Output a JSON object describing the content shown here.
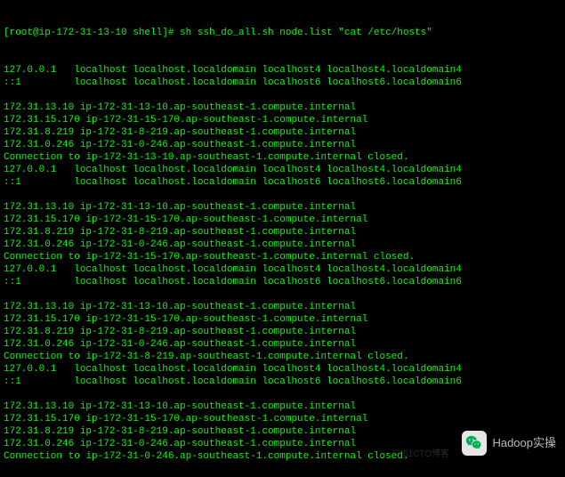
{
  "prompt": "[root@ip-172-31-13-10 shell]# sh ssh_do_all.sh node.list \"cat /etc/hosts\"",
  "lines": [
    "127.0.0.1   localhost localhost.localdomain localhost4 localhost4.localdomain4",
    "::1         localhost localhost.localdomain localhost6 localhost6.localdomain6",
    "",
    "172.31.13.10 ip-172-31-13-10.ap-southeast-1.compute.internal",
    "172.31.15.170 ip-172-31-15-170.ap-southeast-1.compute.internal",
    "172.31.8.219 ip-172-31-8-219.ap-southeast-1.compute.internal",
    "172.31.0.246 ip-172-31-0-246.ap-southeast-1.compute.internal",
    "Connection to ip-172-31-13-10.ap-southeast-1.compute.internal closed.",
    "127.0.0.1   localhost localhost.localdomain localhost4 localhost4.localdomain4",
    "::1         localhost localhost.localdomain localhost6 localhost6.localdomain6",
    "",
    "172.31.13.10 ip-172-31-13-10.ap-southeast-1.compute.internal",
    "172.31.15.170 ip-172-31-15-170.ap-southeast-1.compute.internal",
    "172.31.8.219 ip-172-31-8-219.ap-southeast-1.compute.internal",
    "172.31.0.246 ip-172-31-0-246.ap-southeast-1.compute.internal",
    "Connection to ip-172-31-15-170.ap-southeast-1.compute.internal closed.",
    "127.0.0.1   localhost localhost.localdomain localhost4 localhost4.localdomain4",
    "::1         localhost localhost.localdomain localhost6 localhost6.localdomain6",
    "",
    "172.31.13.10 ip-172-31-13-10.ap-southeast-1.compute.internal",
    "172.31.15.170 ip-172-31-15-170.ap-southeast-1.compute.internal",
    "172.31.8.219 ip-172-31-8-219.ap-southeast-1.compute.internal",
    "172.31.0.246 ip-172-31-0-246.ap-southeast-1.compute.internal",
    "Connection to ip-172-31-8-219.ap-southeast-1.compute.internal closed.",
    "127.0.0.1   localhost localhost.localdomain localhost4 localhost4.localdomain4",
    "::1         localhost localhost.localdomain localhost6 localhost6.localdomain6",
    "",
    "172.31.13.10 ip-172-31-13-10.ap-southeast-1.compute.internal",
    "172.31.15.170 ip-172-31-15-170.ap-southeast-1.compute.internal",
    "172.31.8.219 ip-172-31-8-219.ap-southeast-1.compute.internal",
    "172.31.0.246 ip-172-31-0-246.ap-southeast-1.compute.internal",
    "Connection to ip-172-31-0-246.ap-southeast-1.compute.internal closed."
  ],
  "watermark": {
    "text": "Hadoop实操",
    "faded": "@ 51CTO博客"
  }
}
